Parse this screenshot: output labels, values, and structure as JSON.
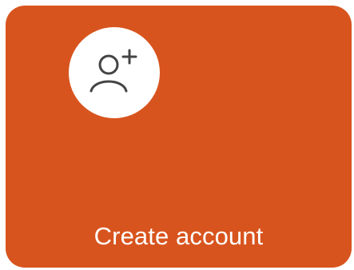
{
  "tile": {
    "label": "Create account",
    "icon": "add-user-icon",
    "background_color": "#d8541e",
    "icon_background_color": "#ffffff",
    "icon_color": "#444444",
    "text_color": "#ffffff"
  }
}
